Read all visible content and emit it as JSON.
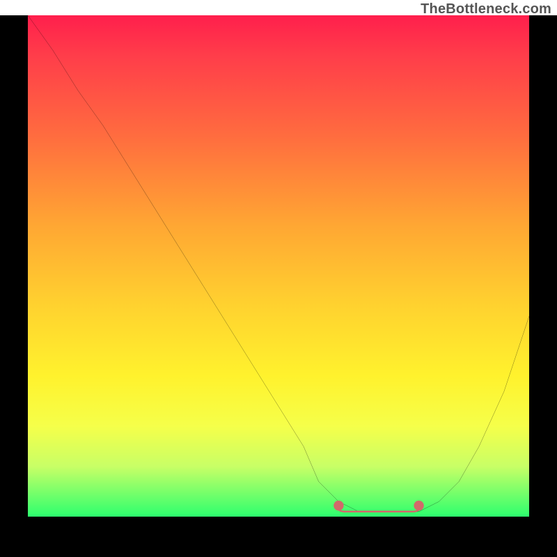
{
  "watermark": "TheBottleneck.com",
  "chart_data": {
    "type": "line",
    "title": "",
    "xlabel": "",
    "ylabel": "",
    "xlim": [
      0,
      100
    ],
    "ylim": [
      0,
      100
    ],
    "grid": false,
    "legend": false,
    "series": [
      {
        "name": "bottleneck-curve",
        "color": "#000000",
        "x": [
          0,
          5,
          10,
          15,
          20,
          25,
          30,
          35,
          40,
          45,
          50,
          55,
          58,
          62,
          66,
          70,
          74,
          78,
          82,
          86,
          90,
          95,
          100
        ],
        "values": [
          100,
          93,
          85,
          78,
          70,
          62,
          54,
          46,
          38,
          30,
          22,
          14,
          7,
          3,
          1,
          1,
          1,
          1,
          3,
          7,
          14,
          25,
          40
        ]
      }
    ],
    "annotations": [
      {
        "type": "flat-marker",
        "name": "optimal-range-marker",
        "color": "#d16a6a",
        "x_start": 62,
        "x_end": 78,
        "y": 1,
        "dot_radius": 1,
        "thickness": 2.5
      }
    ],
    "background_gradient": {
      "direction": "top-to-bottom",
      "stops": [
        {
          "pos": 0,
          "color": "#ff1f4c"
        },
        {
          "pos": 8,
          "color": "#ff3d4a"
        },
        {
          "pos": 24,
          "color": "#ff6c3f"
        },
        {
          "pos": 42,
          "color": "#ffa733"
        },
        {
          "pos": 58,
          "color": "#ffd22f"
        },
        {
          "pos": 72,
          "color": "#fff22d"
        },
        {
          "pos": 82,
          "color": "#f5ff4a"
        },
        {
          "pos": 90,
          "color": "#c8ff66"
        },
        {
          "pos": 96,
          "color": "#6bff6b"
        },
        {
          "pos": 100,
          "color": "#2dff6e"
        }
      ]
    }
  }
}
